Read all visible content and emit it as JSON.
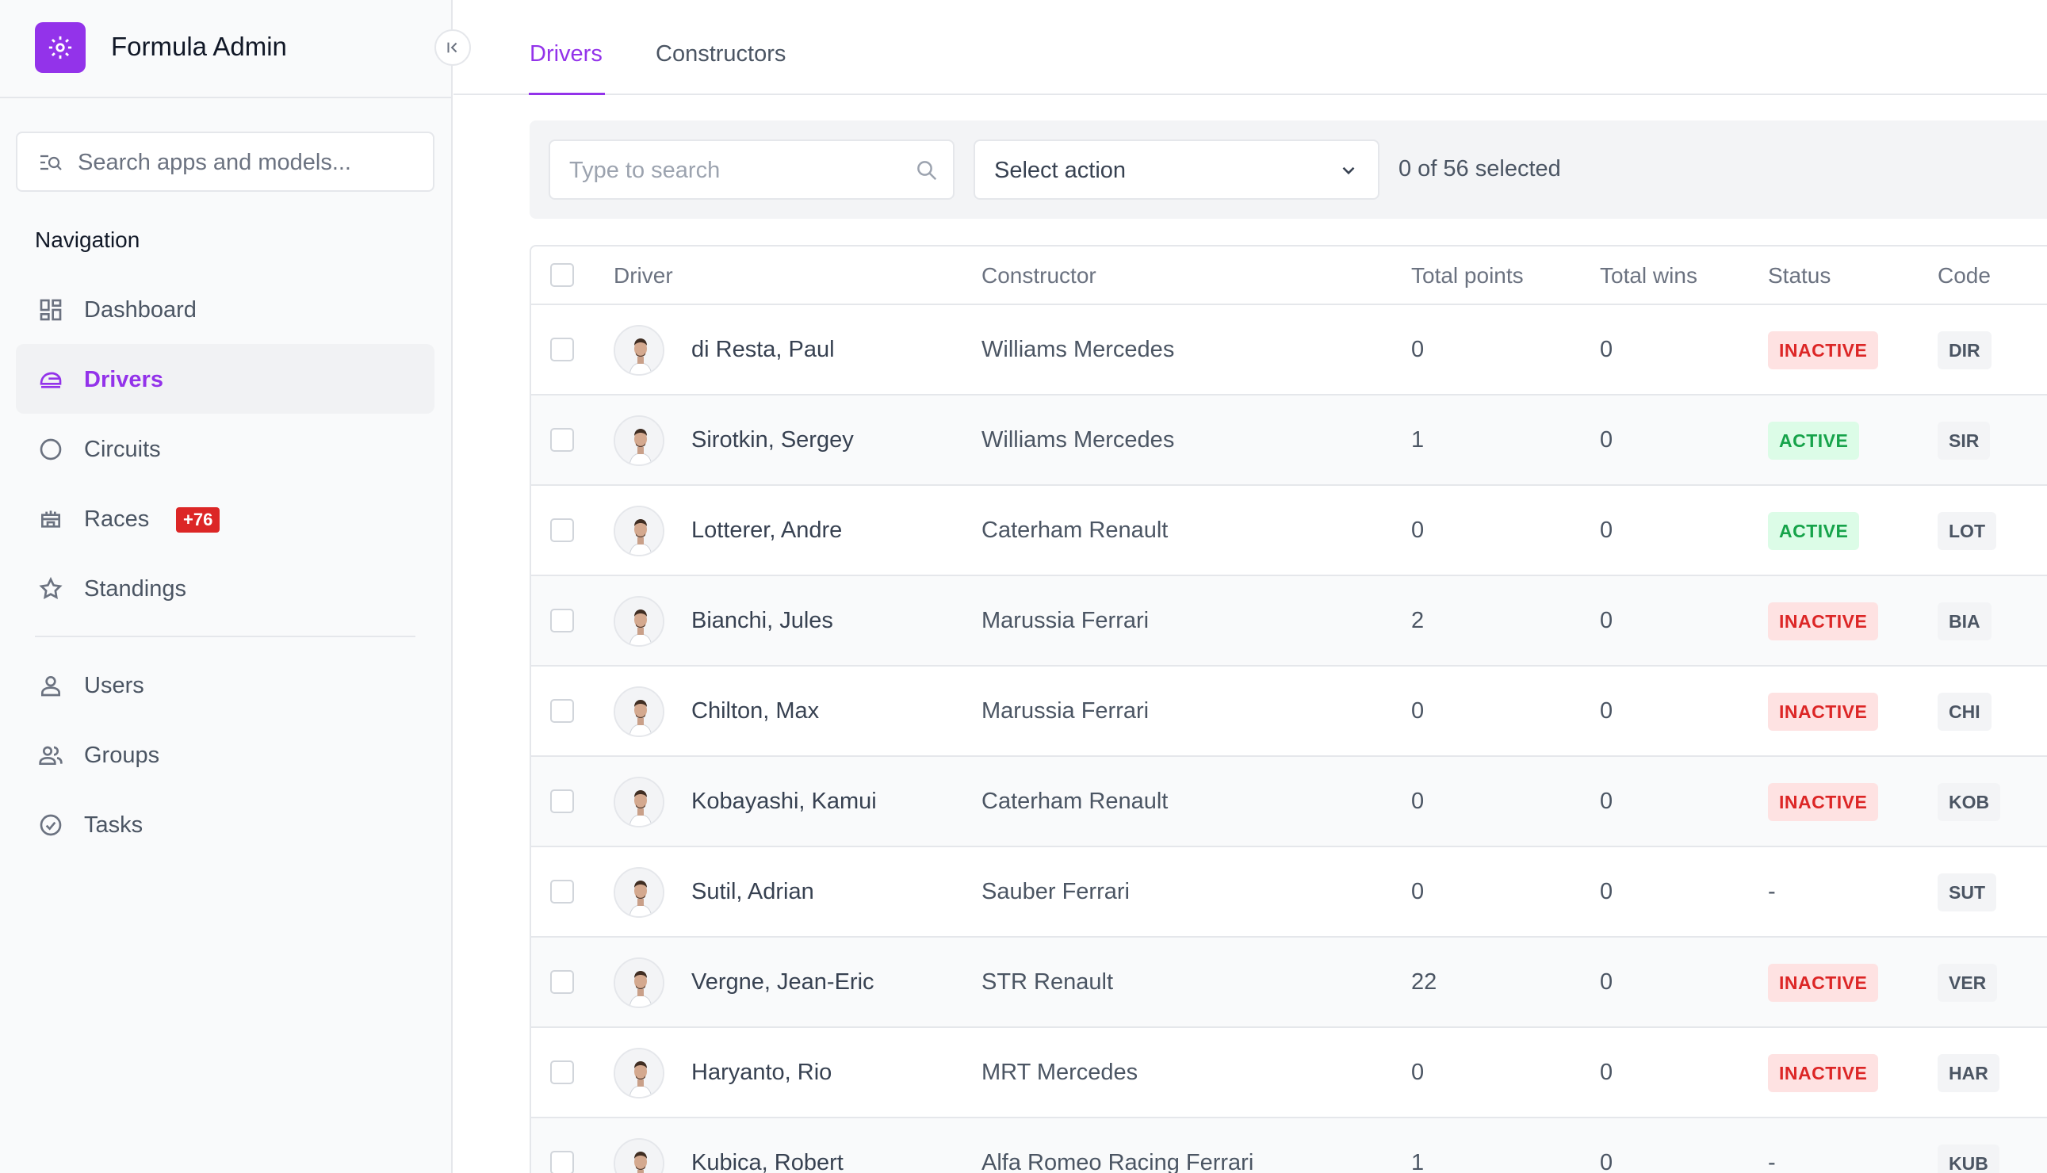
{
  "brand": {
    "title": "Formula Admin",
    "icon": "gear-icon",
    "accent": "#9333ea"
  },
  "sidebar": {
    "search_placeholder": "Search apps and models...",
    "nav_title": "Navigation",
    "items": [
      {
        "label": "Dashboard",
        "icon": "grid-icon",
        "active": false
      },
      {
        "label": "Drivers",
        "icon": "helmet-icon",
        "active": true
      },
      {
        "label": "Circuits",
        "icon": "circle-icon",
        "active": false
      },
      {
        "label": "Races",
        "icon": "stadium-icon",
        "active": false,
        "badge": "+76"
      },
      {
        "label": "Standings",
        "icon": "star-icon",
        "active": false
      },
      {
        "label": "Users",
        "icon": "person-icon",
        "active": false
      },
      {
        "label": "Groups",
        "icon": "people-icon",
        "active": false
      },
      {
        "label": "Tasks",
        "icon": "check-circle-icon",
        "active": false
      }
    ]
  },
  "tabs": [
    {
      "label": "Drivers",
      "active": true
    },
    {
      "label": "Constructors",
      "active": false
    }
  ],
  "toolbar": {
    "search_placeholder": "Type to search",
    "action_label": "Select action",
    "selected_text": "0 of 56 selected"
  },
  "table": {
    "headers": {
      "driver": "Driver",
      "constructor": "Constructor",
      "points": "Total points",
      "wins": "Total wins",
      "status": "Status",
      "code": "Code"
    },
    "rows": [
      {
        "name": "di Resta, Paul",
        "constructor": "Williams Mercedes",
        "points": "0",
        "wins": "0",
        "status": "INACTIVE",
        "code": "DIR"
      },
      {
        "name": "Sirotkin, Sergey",
        "constructor": "Williams Mercedes",
        "points": "1",
        "wins": "0",
        "status": "ACTIVE",
        "code": "SIR"
      },
      {
        "name": "Lotterer, Andre",
        "constructor": "Caterham Renault",
        "points": "0",
        "wins": "0",
        "status": "ACTIVE",
        "code": "LOT"
      },
      {
        "name": "Bianchi, Jules",
        "constructor": "Marussia Ferrari",
        "points": "2",
        "wins": "0",
        "status": "INACTIVE",
        "code": "BIA"
      },
      {
        "name": "Chilton, Max",
        "constructor": "Marussia Ferrari",
        "points": "0",
        "wins": "0",
        "status": "INACTIVE",
        "code": "CHI"
      },
      {
        "name": "Kobayashi, Kamui",
        "constructor": "Caterham Renault",
        "points": "0",
        "wins": "0",
        "status": "INACTIVE",
        "code": "KOB"
      },
      {
        "name": "Sutil, Adrian",
        "constructor": "Sauber Ferrari",
        "points": "0",
        "wins": "0",
        "status": "-",
        "code": "SUT"
      },
      {
        "name": "Vergne, Jean-Eric",
        "constructor": "STR Renault",
        "points": "22",
        "wins": "0",
        "status": "INACTIVE",
        "code": "VER"
      },
      {
        "name": "Haryanto, Rio",
        "constructor": "MRT Mercedes",
        "points": "0",
        "wins": "0",
        "status": "INACTIVE",
        "code": "HAR"
      },
      {
        "name": "Kubica, Robert",
        "constructor": "Alfa Romeo Racing Ferrari",
        "points": "1",
        "wins": "0",
        "status": "-",
        "code": "KUB"
      }
    ]
  },
  "colors": {
    "accent": "#9333ea",
    "inactive_bg": "#fee2e2",
    "inactive_text": "#dc2626",
    "active_bg": "#dcfce7",
    "active_text": "#16a34a",
    "badge_red": "#dc2626"
  }
}
